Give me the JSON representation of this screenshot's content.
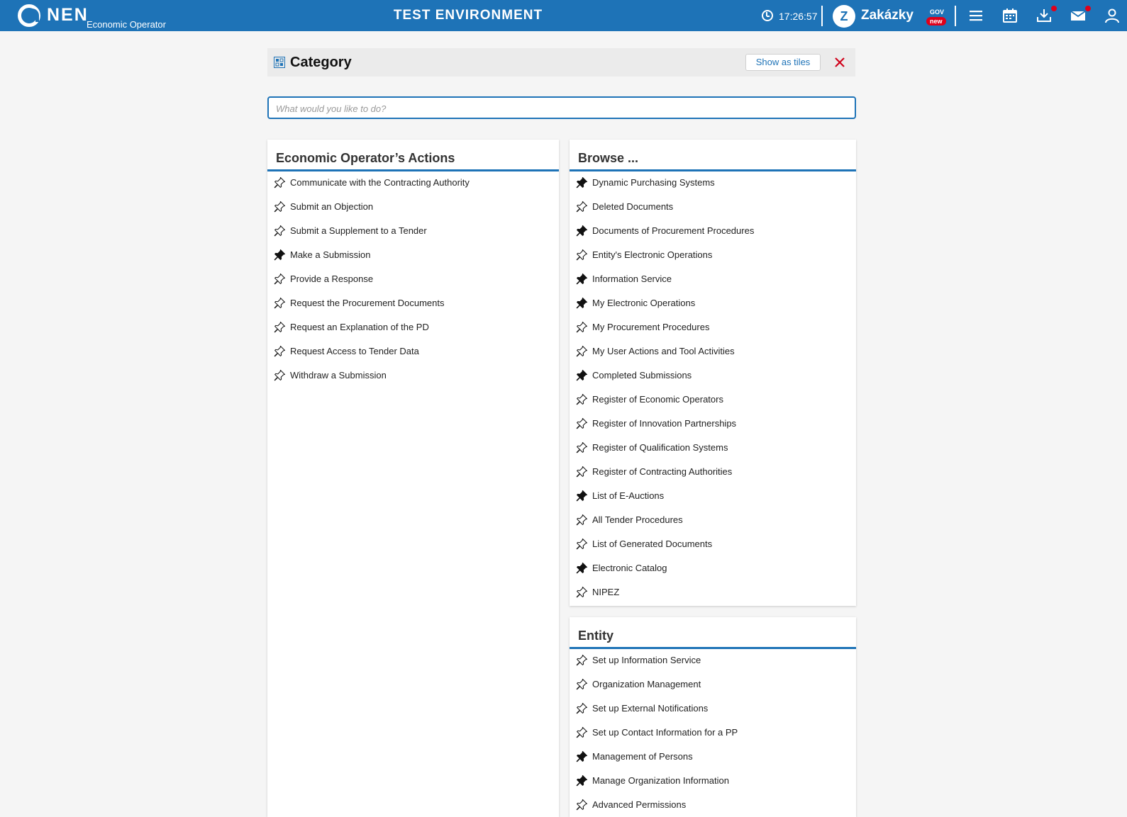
{
  "header": {
    "logo_text": "NEN",
    "logo_subtitle": "Economic Operator",
    "environment_title": "TEST ENVIRONMENT",
    "clock_time": "17:26:57",
    "zakazky_label": "Zakázky",
    "zakazky_sup": "GOV",
    "zakazky_badge": "new",
    "zakazky_badge_color": "#e0001a",
    "accent_color": "#1e73b7",
    "icons": [
      "clock-icon",
      "menu-icon",
      "calendar-icon",
      "download-icon",
      "mail-icon",
      "user-icon"
    ]
  },
  "category_bar": {
    "title": "Category",
    "tiles_button": "Show as tiles",
    "close_icon": "close-icon"
  },
  "search": {
    "placeholder": "What would you like to do?",
    "value": ""
  },
  "panels": {
    "actions": {
      "title": "Economic Operator’s Actions",
      "items": [
        {
          "label": "Communicate with the Contracting Authority",
          "pinned": false
        },
        {
          "label": "Submit an Objection",
          "pinned": false
        },
        {
          "label": "Submit a Supplement to a Tender",
          "pinned": false
        },
        {
          "label": "Make a Submission",
          "pinned": true
        },
        {
          "label": "Provide a Response",
          "pinned": false
        },
        {
          "label": "Request the Procurement Documents",
          "pinned": false
        },
        {
          "label": "Request an Explanation of the PD",
          "pinned": false
        },
        {
          "label": "Request Access to Tender Data",
          "pinned": false
        },
        {
          "label": "Withdraw a Submission",
          "pinned": false
        }
      ]
    },
    "browse": {
      "title": "Browse ...",
      "items": [
        {
          "label": "Dynamic Purchasing Systems",
          "pinned": true
        },
        {
          "label": "Deleted Documents",
          "pinned": false
        },
        {
          "label": "Documents of Procurement Procedures",
          "pinned": true
        },
        {
          "label": "Entity's Electronic Operations",
          "pinned": false
        },
        {
          "label": "Information Service",
          "pinned": true
        },
        {
          "label": "My Electronic Operations",
          "pinned": true
        },
        {
          "label": "My Procurement Procedures",
          "pinned": false
        },
        {
          "label": "My User Actions and Tool Activities",
          "pinned": false
        },
        {
          "label": "Completed Submissions",
          "pinned": true
        },
        {
          "label": "Register of Economic Operators",
          "pinned": false
        },
        {
          "label": "Register of Innovation Partnerships",
          "pinned": false
        },
        {
          "label": "Register of Qualification Systems",
          "pinned": false
        },
        {
          "label": "Register of Contracting Authorities",
          "pinned": false
        },
        {
          "label": "List of E-Auctions",
          "pinned": true
        },
        {
          "label": "All Tender Procedures",
          "pinned": false
        },
        {
          "label": "List of Generated Documents",
          "pinned": false
        },
        {
          "label": "Electronic Catalog",
          "pinned": true
        },
        {
          "label": "NIPEZ",
          "pinned": false
        }
      ]
    },
    "entity": {
      "title": "Entity",
      "items": [
        {
          "label": "Set up Information Service",
          "pinned": false
        },
        {
          "label": "Organization Management",
          "pinned": false
        },
        {
          "label": "Set up External Notifications",
          "pinned": false
        },
        {
          "label": "Set up Contact Information for a PP",
          "pinned": false
        },
        {
          "label": "Management of Persons",
          "pinned": true
        },
        {
          "label": "Manage Organization Information",
          "pinned": true
        },
        {
          "label": "Advanced Permissions",
          "pinned": false
        }
      ]
    }
  }
}
